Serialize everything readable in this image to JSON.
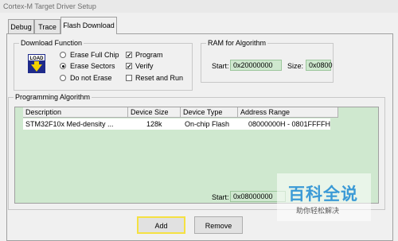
{
  "window": {
    "title": "Cortex-M Target Driver Setup"
  },
  "tabs": [
    {
      "label": "Debug"
    },
    {
      "label": "Trace"
    },
    {
      "label": "Flash Download"
    }
  ],
  "download_function": {
    "title": "Download Function",
    "icon_text": "LOAD",
    "options": [
      {
        "label": "Erase Full Chip",
        "selected": false
      },
      {
        "label": "Erase Sectors",
        "selected": true
      },
      {
        "label": "Do not Erase",
        "selected": false
      }
    ],
    "checks": [
      {
        "label": "Program",
        "checked": true
      },
      {
        "label": "Verify",
        "checked": true
      },
      {
        "label": "Reset and Run",
        "checked": false
      }
    ]
  },
  "ram": {
    "title": "RAM for Algorithm",
    "start_label": "Start:",
    "start_value": "0x20000000",
    "size_label": "Size:",
    "size_value": "0x0800"
  },
  "programming": {
    "title": "Programming Algorithm",
    "columns": [
      "Description",
      "Device Size",
      "Device Type",
      "Address Range"
    ],
    "rows": [
      [
        "STM32F10x Med-density ...",
        "128k",
        "On-chip Flash",
        "08000000H - 0801FFFFH"
      ]
    ],
    "start_label": "Start:",
    "start_value": "0x08000000"
  },
  "buttons": {
    "add": "Add",
    "remove": "Remove"
  },
  "watermark": {
    "main": "百科全说",
    "sub": "助你轻松解决"
  },
  "colors": {
    "field_bg": "#cfe8cf",
    "focus": "#f5e142",
    "watermark": "#3b9ad6"
  }
}
